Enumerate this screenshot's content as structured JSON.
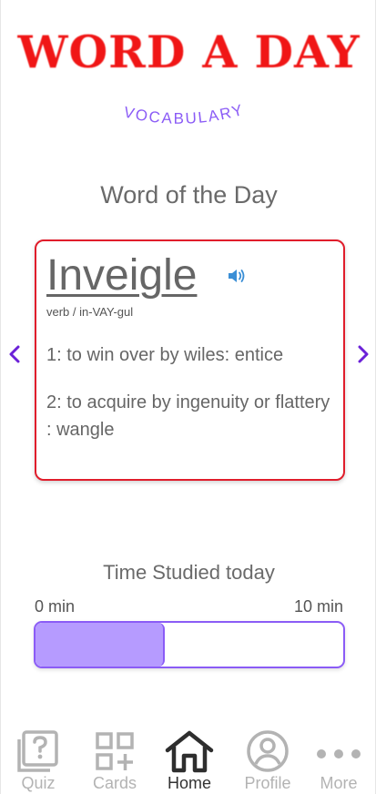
{
  "app": {
    "logo_text": "WORD A DAY",
    "subtitle": "VOCABULARY",
    "subtitle_color": "#8b5cf6",
    "logo_color": "#f01616"
  },
  "word_of_day": {
    "heading": "Word of the Day",
    "word": "Inveigle",
    "pronunciation": "verb / in-VAY-gul",
    "definitions": [
      "1: to win over by wiles: entice",
      "2: to acquire by ingenuity or flattery : wangle"
    ],
    "speaker_icon": "speaker-icon",
    "prev_icon": "chevron-left-icon",
    "next_icon": "chevron-right-icon",
    "card_border_color": "#e01d2b"
  },
  "time_studied": {
    "heading": "Time Studied today",
    "min_label": "0 min",
    "max_label": "10 min",
    "progress_fraction": 0.42,
    "accent_color": "#8b5cf6",
    "fill_color": "#b69bff"
  },
  "tabbar": {
    "items": [
      {
        "label": "Quiz",
        "icon": "quiz-icon",
        "active": false
      },
      {
        "label": "Cards",
        "icon": "cards-icon",
        "active": false
      },
      {
        "label": "Home",
        "icon": "home-icon",
        "active": true
      },
      {
        "label": "Profile",
        "icon": "profile-icon",
        "active": false
      },
      {
        "label": "More",
        "icon": "more-icon",
        "active": false
      }
    ]
  }
}
